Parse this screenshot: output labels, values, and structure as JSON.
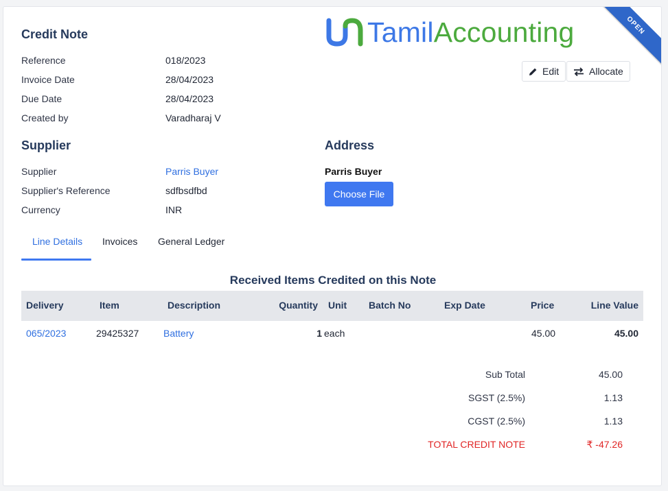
{
  "header": {
    "title": "Credit Note",
    "status_ribbon": "OPEN"
  },
  "logo": {
    "part1": "Tamil",
    "part2": "Accounting"
  },
  "actions": {
    "edit_label": "Edit",
    "allocate_label": "Allocate"
  },
  "details": {
    "reference_label": "Reference",
    "reference_value": "018/2023",
    "invoice_date_label": "Invoice Date",
    "invoice_date_value": "28/04/2023",
    "due_date_label": "Due Date",
    "due_date_value": "28/04/2023",
    "created_by_label": "Created by",
    "created_by_value": "Varadharaj V"
  },
  "supplier": {
    "section_title": "Supplier",
    "supplier_label": "Supplier",
    "supplier_value": "Parris Buyer",
    "ref_label": "Supplier's Reference",
    "ref_value": "sdfbsdfbd",
    "currency_label": "Currency",
    "currency_value": "INR"
  },
  "address": {
    "section_title": "Address",
    "name": "Parris Buyer",
    "choose_file_label": "Choose File"
  },
  "tabs": [
    {
      "label": "Line Details",
      "active": true
    },
    {
      "label": "Invoices",
      "active": false
    },
    {
      "label": "General Ledger",
      "active": false
    }
  ],
  "table": {
    "caption": "Received Items Credited on this Note",
    "columns": [
      "Delivery",
      "Item",
      "Description",
      "Quantity",
      "Unit",
      "Batch No",
      "Exp Date",
      "Price",
      "Line Value"
    ],
    "rows": [
      {
        "delivery": "065/2023",
        "item": "29425327",
        "description": "Battery",
        "quantity": "1",
        "unit": "each",
        "batch_no": "",
        "exp_date": "",
        "price": "45.00",
        "line_value": "45.00"
      }
    ]
  },
  "totals": {
    "sub_total_label": "Sub Total",
    "sub_total_value": "45.00",
    "sgst_label": "SGST (2.5%)",
    "sgst_value": "1.13",
    "cgst_label": "CGST (2.5%)",
    "cgst_value": "1.13",
    "total_label": "TOTAL CREDIT NOTE",
    "total_value": "₹ -47.26"
  },
  "colors": {
    "accent": "#3f78f0",
    "link": "#2f6fe0",
    "heading": "#263a5c",
    "danger": "#e02424",
    "logo_green": "#4caa3e"
  }
}
